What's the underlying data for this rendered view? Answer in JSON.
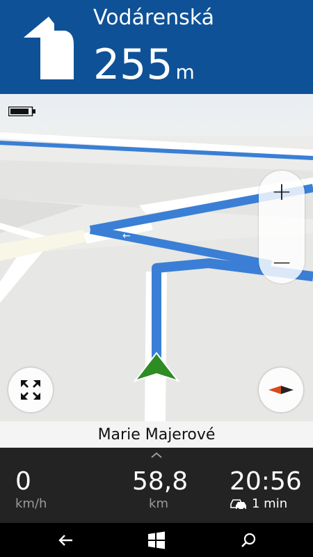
{
  "header": {
    "street": "Vodárenská",
    "distance_value": "255",
    "distance_unit": "m",
    "turn_icon": "turn-left-arrow-icon"
  },
  "map": {
    "battery_icon": "battery-icon",
    "zoom_in_label": "+",
    "zoom_out_label": "−",
    "expand_icon": "expand-arrows-icon",
    "compass_icon": "compass-icon",
    "position_icon": "current-position-arrow-icon"
  },
  "current_street": "Marie Majerové",
  "stats": {
    "speed_value": "0",
    "speed_unit": "km/h",
    "distance_value": "58,8",
    "distance_unit": "km",
    "arrival_time": "20:56",
    "delay_text": "1 min",
    "delay_icon": "traffic-cars-icon"
  },
  "navbar": {
    "back_icon": "back-arrow-icon",
    "home_icon": "windows-logo-icon",
    "search_icon": "search-icon"
  },
  "colors": {
    "header_bg": "#0f5196",
    "route": "#3a7fd5",
    "position_arrow": "#2d8c24",
    "bottom_bg": "#232323"
  }
}
